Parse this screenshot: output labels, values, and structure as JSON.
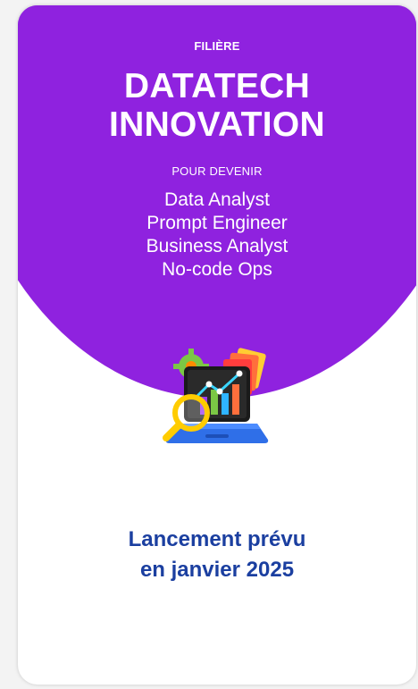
{
  "hero": {
    "kicker": "FILIÈRE",
    "title_line1": "DATATECH",
    "title_line2": "INNOVATION",
    "subtitle": "POUR DEVENIR",
    "roles": [
      "Data Analyst",
      "Prompt Engineer",
      "Business Analyst",
      "No-code Ops"
    ]
  },
  "illustration": {
    "icon": "laptop-analytics-icon"
  },
  "launch": {
    "line1": "Lancement prévu",
    "line2": "en janvier 2025"
  },
  "colors": {
    "hero_bg": "#8f22df",
    "launch_text": "#1b3fa0",
    "card_bg": "#ffffff"
  }
}
